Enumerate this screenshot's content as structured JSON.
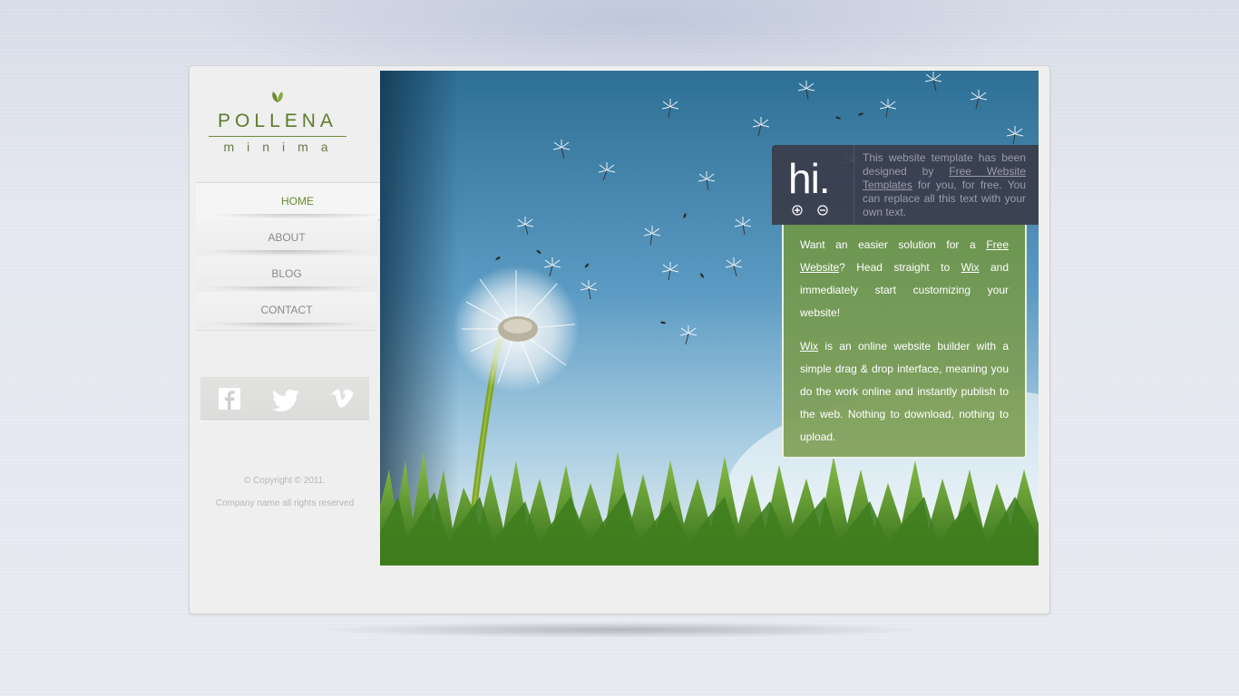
{
  "brand": {
    "name": "POLLENA",
    "tagline": "minima",
    "leaf_color": "#6b8a2e"
  },
  "nav": {
    "items": [
      {
        "label": "HOME",
        "active": true
      },
      {
        "label": "ABOUT",
        "active": false
      },
      {
        "label": "BLOG",
        "active": false
      },
      {
        "label": "CONTACT",
        "active": false
      }
    ]
  },
  "social": {
    "icons": [
      "facebook-icon",
      "twitter-icon",
      "vimeo-icon"
    ]
  },
  "footer": {
    "copyright": "© Copyright © 2011.",
    "rights": "Company name all rights reserved"
  },
  "hero": {
    "image": "dandelion-over-grass"
  },
  "hi_box": {
    "heading": "hi.",
    "text_before": "This website template has been designed by ",
    "link": "Free Website Templates",
    "text_after": " for you, for free. You can replace all this text with your own text.",
    "zoom_in_icon": "plus-circle-icon",
    "zoom_out_icon": "minus-circle-icon"
  },
  "promo": {
    "p1_a": "Want an easier solution for a ",
    "p1_link": "Free Website",
    "p1_b": "? Head straight to ",
    "p1_link2": "Wix",
    "p1_c": " and immediately start customizing your website!",
    "p2_link": "Wix",
    "p2_text": " is an online website builder with a simple drag & drop interface, meaning you do the work online and instantly publish to the web. Nothing to download, nothing to upload."
  },
  "colors": {
    "accent": "#6a8a30",
    "panel": "#3a3c4a",
    "promo_green": "#78a050"
  }
}
